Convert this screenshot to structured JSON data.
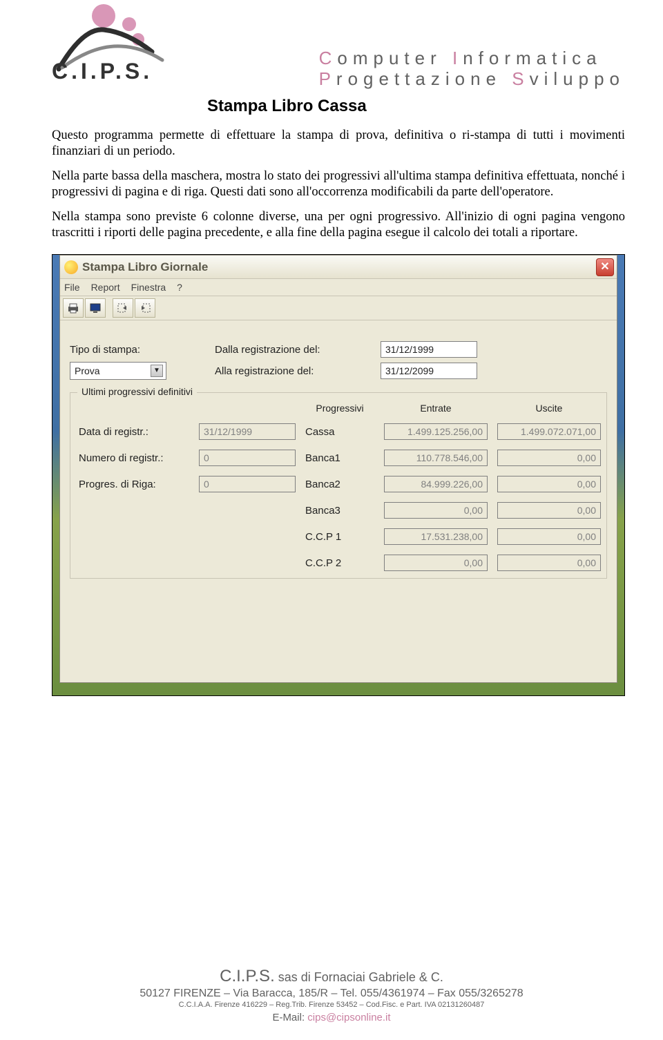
{
  "header": {
    "logo_text": "C.I.P.S.",
    "right_line1_pre": "C",
    "right_line1_word1": "omputer ",
    "right_line1_pre2": "I",
    "right_line1_word2": "nformatica",
    "right_line2_pre": "P",
    "right_line2_word1": "rogettazione ",
    "right_line2_pre2": "S",
    "right_line2_word2": "viluppo",
    "title": "Stampa Libro Cassa"
  },
  "paragraphs": {
    "p1": "Questo programma permette di effettuare la stampa di prova, definitiva o ri-stampa di tutti i movimenti finanziari di un periodo.",
    "p2": "Nella parte bassa della maschera, mostra lo stato dei progressivi  all'ultima stampa definitiva effettuata, nonché i progressivi di pagina e di riga. Questi dati sono all'occorrenza modificabili da parte dell'operatore.",
    "p3": "Nella stampa sono previste 6 colonne diverse, una per ogni progressivo. All'inizio di ogni pagina vengono trascritti i riporti delle pagina precedente, e alla fine della pagina esegue il calcolo dei totali a riportare."
  },
  "window": {
    "title": "Stampa Libro Giornale",
    "menu": [
      "File",
      "Report",
      "Finestra",
      "?"
    ],
    "form": {
      "tipo_label": "Tipo di stampa:",
      "tipo_value": "Prova",
      "dalla_label": "Dalla registrazione del:",
      "dalla_value": "31/12/1999",
      "alla_label": "Alla registrazione del:",
      "alla_value": "31/12/2099"
    },
    "group": {
      "legend": "Ultimi progressivi definitivi",
      "col_prog": "Progressivi",
      "col_ent": "Entrate",
      "col_usc": "Uscite",
      "data_label": "Data di registr.:",
      "data_value": "31/12/1999",
      "num_label": "Numero di registr.:",
      "num_value": "0",
      "riga_label": "Progres. di Riga:",
      "riga_value": "0",
      "rows": [
        {
          "name": "Cassa",
          "ent": "1.499.125.256,00",
          "usc": "1.499.072.071,00"
        },
        {
          "name": "Banca1",
          "ent": "110.778.546,00",
          "usc": "0,00"
        },
        {
          "name": "Banca2",
          "ent": "84.999.226,00",
          "usc": "0,00"
        },
        {
          "name": "Banca3",
          "ent": "0,00",
          "usc": "0,00"
        },
        {
          "name": "C.C.P 1",
          "ent": "17.531.238,00",
          "usc": "0,00"
        },
        {
          "name": "C.C.P 2",
          "ent": "0,00",
          "usc": "0,00"
        }
      ]
    }
  },
  "footer": {
    "l1a": "C.I.P.S.",
    "l1b": " sas ",
    "l1c": "di Fornaciai Gabriele & C.",
    "l2": "50127 FIRENZE – Via Baracca, 185/R – Tel. 055/4361974 – Fax 055/3265278",
    "l3": "C.C.I.A.A. Firenze 416229 – Reg.Trib. Firenze 53452 – Cod.Fisc. e Part. IVA 02131260487",
    "l4_pre": "E-Mail: ",
    "l4_email": "cips@cipsonline.it"
  }
}
